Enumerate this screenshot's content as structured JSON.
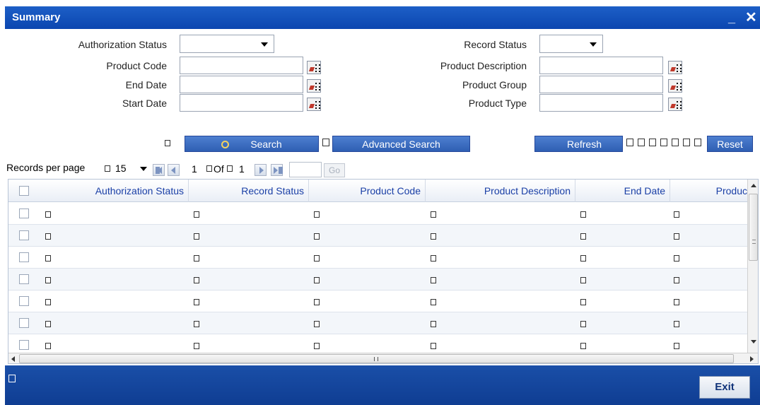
{
  "window": {
    "title": "Summary",
    "minimize_glyph": "_",
    "close_glyph": "✕"
  },
  "form": {
    "left": [
      {
        "label": "Authorization Status",
        "type": "select",
        "value": ""
      },
      {
        "label": "Product Code",
        "type": "text",
        "value": ""
      },
      {
        "label": "End Date",
        "type": "text",
        "value": ""
      },
      {
        "label": "Start Date",
        "type": "text",
        "value": ""
      }
    ],
    "right": [
      {
        "label": "Record Status",
        "type": "select",
        "value": ""
      },
      {
        "label": "Product Description",
        "type": "text",
        "value": ""
      },
      {
        "label": "Product Group",
        "type": "text",
        "value": ""
      },
      {
        "label": "Product Type",
        "type": "text",
        "value": ""
      }
    ]
  },
  "actions": {
    "search_label": "Search",
    "advanced_search_label": "Advanced Search",
    "refresh_label": "Refresh",
    "reset_label": "Reset"
  },
  "pager": {
    "records_per_page_label": "Records per page",
    "records_per_page_value": "15",
    "current_page": "1",
    "of_label": "Of",
    "total_pages": "1",
    "go_label": "Go"
  },
  "grid": {
    "columns": [
      "Authorization Status",
      "Record Status",
      "Product Code",
      "Product Description",
      "End Date",
      "Produc"
    ],
    "row_count": 7,
    "cell_text": ""
  },
  "footer": {
    "exit_label": "Exit"
  },
  "icons": {
    "lov": "list-of-values-icon",
    "search": "search-icon",
    "first": "first-page-icon",
    "prev": "previous-page-icon",
    "next": "next-page-icon",
    "last": "last-page-icon"
  },
  "colors": {
    "titlebar": "#0b46b0",
    "button": "#2f5fb3",
    "header_text": "#1a3fa6",
    "footer": "#0f3d92"
  }
}
